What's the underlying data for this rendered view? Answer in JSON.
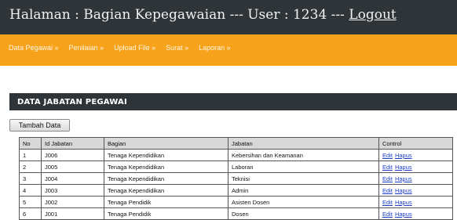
{
  "header": {
    "prefix": "Halaman : Bagian Kepegawaian --- User : 1234 --- ",
    "logout_label": "Logout"
  },
  "nav": {
    "items": [
      "Data Pegawai »",
      "Penilaian »",
      "Upload File »",
      "Surat »",
      "Laporan »"
    ]
  },
  "panel": {
    "title": "DATA JABATAN PEGAWAI",
    "add_button": "Tambah Data"
  },
  "table": {
    "columns": [
      "No",
      "Id Jabatan",
      "Bagian",
      "Jabatan",
      "Control"
    ],
    "rows": [
      {
        "no": "1",
        "id": "J006",
        "bagian": "Tenaga Kependidikan",
        "jabatan": "Kebersihan dan Keamanan"
      },
      {
        "no": "2",
        "id": "J005",
        "bagian": "Tenaga Kependidikan",
        "jabatan": "Laboran"
      },
      {
        "no": "3",
        "id": "J004",
        "bagian": "Tenaga Kependidikan",
        "jabatan": "Teknisi"
      },
      {
        "no": "4",
        "id": "J003",
        "bagian": "Tenaga Kependidikan",
        "jabatan": "Admin"
      },
      {
        "no": "5",
        "id": "J002",
        "bagian": "Tenaga Pendidik",
        "jabatan": "Asisten Dosen"
      },
      {
        "no": "6",
        "id": "J001",
        "bagian": "Tenaga Pendidik",
        "jabatan": "Dosen"
      }
    ],
    "edit_label": "Edit",
    "delete_label": "Hapus"
  },
  "colors": {
    "header_bg": "#2e3437",
    "nav_bg": "#f7a21b",
    "link": "#1a3ec8"
  }
}
